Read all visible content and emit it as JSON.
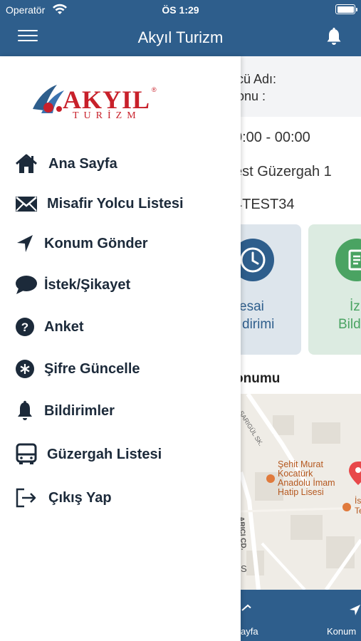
{
  "status_bar": {
    "carrier": "Operatör",
    "time": "ÖS 1:29"
  },
  "header": {
    "title": "Akyıl Turizm"
  },
  "logo": {
    "brand": "AKYIL",
    "sub": "TURİZM",
    "mark": "®"
  },
  "drawer": {
    "items": [
      {
        "label": "Ana Sayfa",
        "icon": "home-icon"
      },
      {
        "label": "Misafir Yolcu Listesi",
        "icon": "envelope-icon"
      },
      {
        "label": "Konum Gönder",
        "icon": "location-arrow-icon"
      },
      {
        "label": "İstek/Şikayet",
        "icon": "chat-bubble-icon"
      },
      {
        "label": "Anket",
        "icon": "question-circle-icon"
      },
      {
        "label": "Şifre Güncelle",
        "icon": "asterisk-circle-icon"
      },
      {
        "label": "Bildirimler",
        "icon": "bell-icon"
      },
      {
        "label": "Güzergah Listesi",
        "icon": "bus-icon"
      },
      {
        "label": "Çıkış Yap",
        "icon": "logout-icon"
      }
    ]
  },
  "main": {
    "info_line1": "cü Adı:",
    "info_line2": "onu   :",
    "time_range": "0:00 - 00:00",
    "route": "est Güzergah 1",
    "plate": "4TEST34",
    "tile1": {
      "line1": "esai",
      "line2": "dirimi"
    },
    "tile2": {
      "line1": "İz",
      "line2": "Bildi"
    },
    "map_title": "onumu",
    "map": {
      "street1": "SARIGÜL SK.",
      "street2": "ARIÇI CD.",
      "poi1": [
        "Şehit Murat",
        "Kocatürk",
        "Anadolu İmam",
        "Hatip Lisesi"
      ],
      "poi2": [
        "İs",
        "Te"
      ],
      "edge_letter": "S"
    },
    "bottom_nav": {
      "left": "ayfa",
      "right": "Konum"
    }
  },
  "colors": {
    "primary": "#2e5e8c",
    "green": "#4aa362",
    "logo_red": "#c8202a"
  }
}
